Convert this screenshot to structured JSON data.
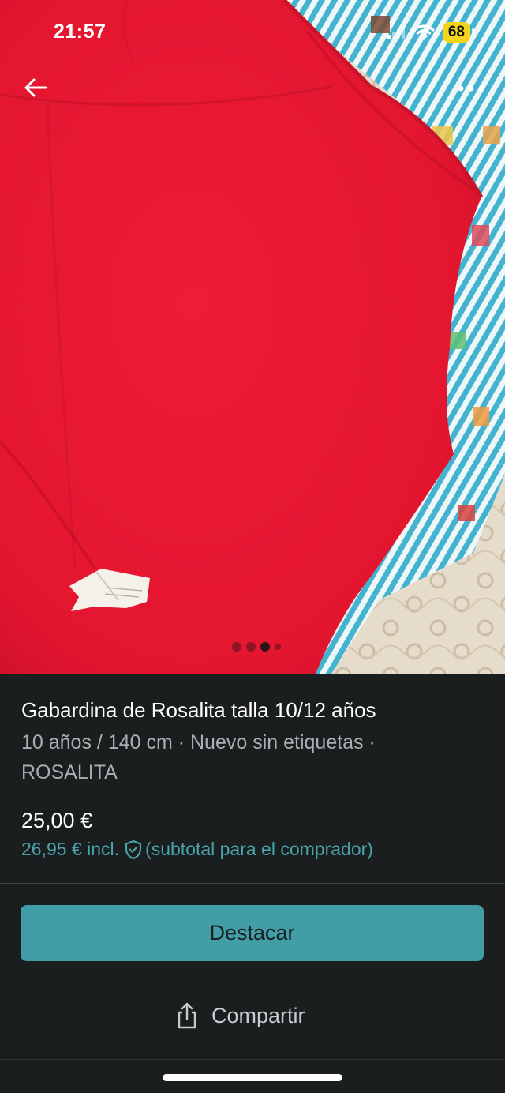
{
  "status_bar": {
    "time": "21:57",
    "battery": "68"
  },
  "photo": {
    "pager": {
      "count": 4,
      "active_index": 2
    }
  },
  "listing": {
    "title": "Gabardina de Rosalita talla 10/12 años",
    "details": "10 años / 140 cm · Nuevo sin etiquetas · ROSALITA",
    "price": "25,00 €",
    "price_incl": "26,95 € incl.",
    "price_note": "(subtotal para el comprador)"
  },
  "actions": {
    "feature_label": "Destacar",
    "share_label": "Compartir"
  },
  "colors": {
    "accent": "#419da6",
    "link": "#4aa3ab",
    "panel_bg": "#1a1e1f",
    "battery": "#f5d51c"
  },
  "icons": {
    "back": "arrow-left-icon",
    "more": "more-dots-icon",
    "shield": "shield-check-icon",
    "share": "share-icon"
  }
}
